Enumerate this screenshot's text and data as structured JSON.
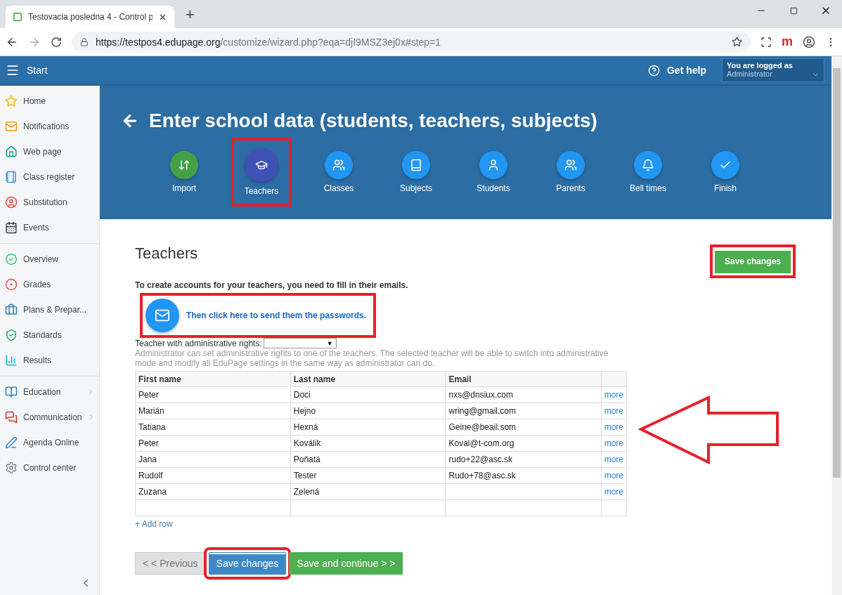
{
  "browser": {
    "tab_title": "Testovacia posledna 4 - Control p",
    "new_tab": "+",
    "url_host": "https://testpos4.edupage.org",
    "url_path": "/customize/wizard.php?eqa=djI9MSZ3ej0x#step=1",
    "extension_label": "m"
  },
  "header": {
    "menu_label": "Start",
    "help_label": "Get help",
    "user_caption": "You are logged as",
    "user_role": "Administrator"
  },
  "sidebar": {
    "groups": [
      [
        {
          "label": "Home",
          "has_submenu": false
        },
        {
          "label": "Notifications",
          "has_submenu": false
        },
        {
          "label": "Web page",
          "has_submenu": false
        },
        {
          "label": "Class register",
          "has_submenu": false
        },
        {
          "label": "Substitution",
          "has_submenu": false
        },
        {
          "label": "Events",
          "has_submenu": false
        }
      ],
      [
        {
          "label": "Overview",
          "has_submenu": false
        },
        {
          "label": "Grades",
          "has_submenu": false
        },
        {
          "label": "Plans & Prepar...",
          "has_submenu": false
        },
        {
          "label": "Standards",
          "has_submenu": false
        },
        {
          "label": "Results",
          "has_submenu": false
        }
      ],
      [
        {
          "label": "Education",
          "has_submenu": true
        },
        {
          "label": "Communication",
          "has_submenu": true
        },
        {
          "label": "Agenda Online",
          "has_submenu": false
        },
        {
          "label": "Control center",
          "has_submenu": false
        }
      ]
    ]
  },
  "wizard": {
    "title": "Enter school data (students, teachers, subjects)",
    "steps": [
      {
        "label": "Import",
        "completed": true,
        "selected": false,
        "highlighted": false
      },
      {
        "label": "Teachers",
        "completed": false,
        "selected": true,
        "highlighted": true
      },
      {
        "label": "Classes",
        "completed": false,
        "selected": false,
        "highlighted": false
      },
      {
        "label": "Subjects",
        "completed": false,
        "selected": false,
        "highlighted": false
      },
      {
        "label": "Students",
        "completed": false,
        "selected": false,
        "highlighted": false
      },
      {
        "label": "Parents",
        "completed": false,
        "selected": false,
        "highlighted": false
      },
      {
        "label": "Bell times",
        "completed": false,
        "selected": false,
        "highlighted": false
      },
      {
        "label": "Finish",
        "completed": false,
        "selected": false,
        "highlighted": false
      }
    ]
  },
  "section": {
    "title": "Teachers",
    "save_button": {
      "label": "Save changes",
      "highlighted": true
    },
    "intro": "To create accounts for your teachers, you need to fill in their emails.",
    "send_link": {
      "label": "Then click here to send them the passwords.",
      "highlighted": true
    },
    "admin_label": "Teacher with administrative rights:",
    "admin_select_arrow": "▼",
    "admin_help": "Administrator can set administrative rights to one of the teachers. The selected teacher will be able to switch into administrative mode and modify all EduPage settings in the same way as administrator can do."
  },
  "table": {
    "columns": [
      "First name",
      "Last name",
      "Email"
    ],
    "rows": [
      {
        "first": "Peter",
        "last": "Doci",
        "email": "nxs@dnsiux.com",
        "action": "more"
      },
      {
        "first": "Marián",
        "last": "Hejno",
        "email": "wring@gmail.com",
        "action": "more"
      },
      {
        "first": "Tatiana",
        "last": "Hexná",
        "email": "Geine@beail.som",
        "action": "more"
      },
      {
        "first": "Peter",
        "last": "Koválik",
        "email": "Koval@t-com.org",
        "action": "more"
      },
      {
        "first": "Jana",
        "last": "Poňatá",
        "email": "rudo+22@asc.sk",
        "action": "more"
      },
      {
        "first": "Rudolf",
        "last": "Tester",
        "email": "Rudo+78@asc.sk",
        "action": "more"
      },
      {
        "first": "Zuzana",
        "last": "Zelená",
        "email": "",
        "action": "more"
      }
    ],
    "add_row": "+ Add row"
  },
  "footer_buttons": [
    {
      "label": "< < Previous",
      "kind": "secondary",
      "highlighted": false
    },
    {
      "label": "Save changes",
      "kind": "primary",
      "highlighted": true
    },
    {
      "label": "Save and continue > >",
      "kind": "success",
      "highlighted": false
    }
  ],
  "annotations": {
    "arrow": true
  }
}
